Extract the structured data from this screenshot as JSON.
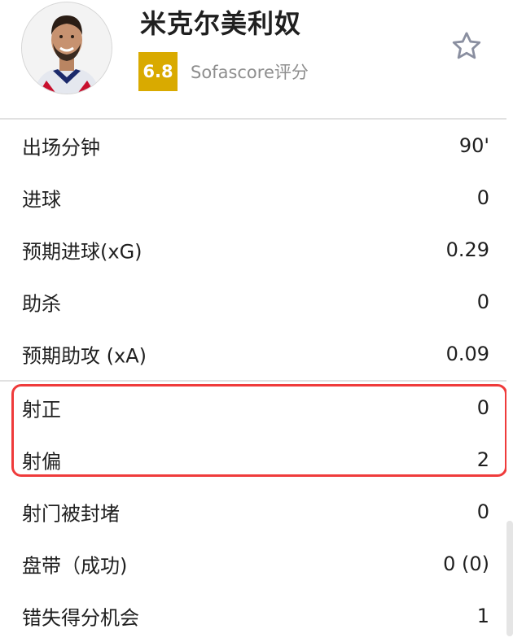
{
  "player": {
    "name": "米克尔美利奴",
    "rating": "6.8",
    "rating_label": "Sofascore评分"
  },
  "icons": {
    "favorite": "star-outline-icon",
    "avatar": "player-photo"
  },
  "colors": {
    "rating_badge": "#d9aa00",
    "highlight_border": "#ef3b3b",
    "divider": "#e1e1e1"
  },
  "stats": {
    "group1": [
      {
        "label": "出场分钟",
        "value": "90'"
      },
      {
        "label": "进球",
        "value": "0"
      },
      {
        "label": "预期进球(xG)",
        "value": "0.29"
      },
      {
        "label": "助杀",
        "value": "0"
      },
      {
        "label": "预期助攻 (xA)",
        "value": "0.09"
      }
    ],
    "group2": [
      {
        "label": "射正",
        "value": "0"
      },
      {
        "label": "射偏",
        "value": "2"
      },
      {
        "label": "射门被封堵",
        "value": "0"
      },
      {
        "label": "盘带（成功)",
        "value": "0 (0)"
      },
      {
        "label": "错失得分机会",
        "value": "1"
      }
    ]
  }
}
